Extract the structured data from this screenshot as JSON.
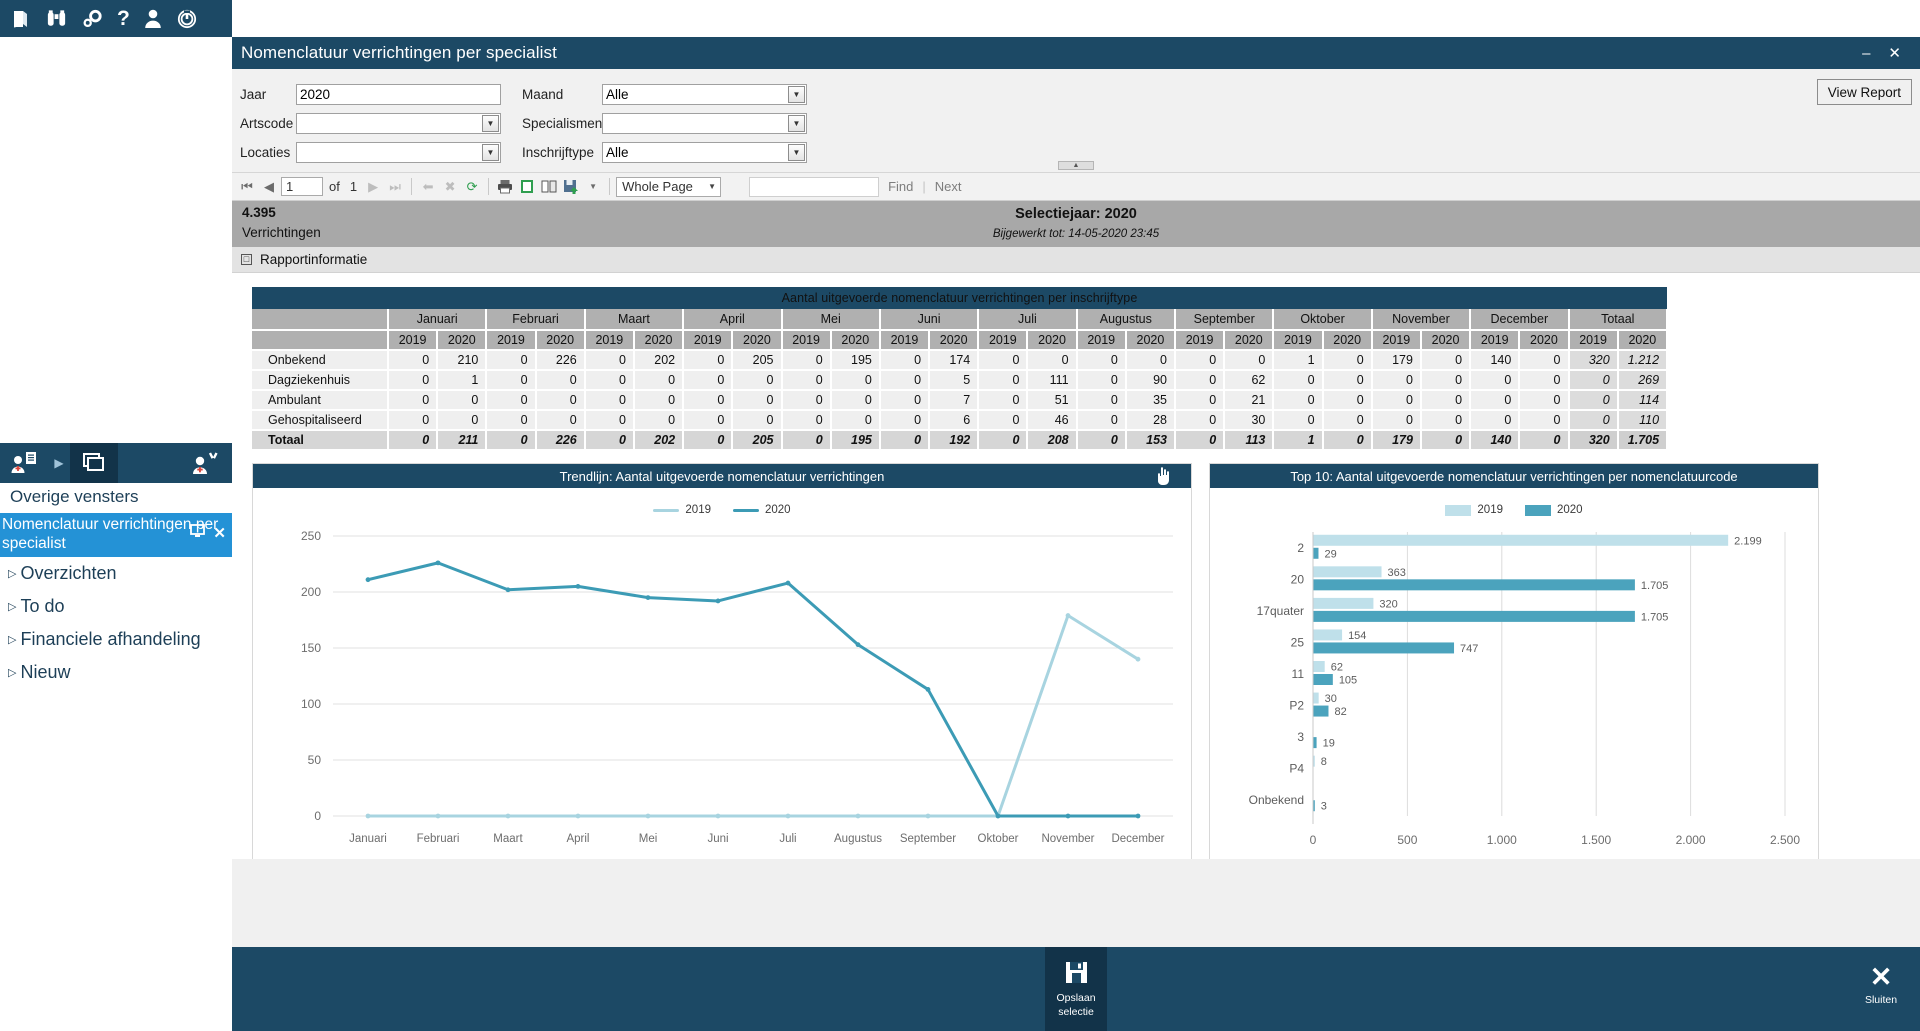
{
  "rail": {
    "icons": [
      "book-icon",
      "binoculars-icon",
      "gears-icon",
      "help-icon",
      "user-icon",
      "power-icon"
    ],
    "window_tabs": [
      "patient-record-icon",
      "chevron-right-icon",
      "windows-icon",
      "patient-search-icon"
    ],
    "overige_vensters_label": "Overige vensters",
    "active_window_label": "Nomenclatuur verrichtingen per specialist",
    "nav_items": [
      {
        "label": "Overzichten"
      },
      {
        "label": "To do"
      },
      {
        "label": "Financiele afhandeling"
      },
      {
        "label": "Nieuw"
      }
    ]
  },
  "window": {
    "title": "Nomenclatuur verrichtingen per specialist",
    "minimize": "–",
    "close": "✕"
  },
  "filters": {
    "left": [
      {
        "label": "Jaar",
        "value": "2020",
        "type": "text"
      },
      {
        "label": "Artscode",
        "value": "",
        "type": "select"
      },
      {
        "label": "Locaties",
        "value": "",
        "type": "select"
      }
    ],
    "right": [
      {
        "label": "Maand",
        "value": "Alle",
        "type": "select"
      },
      {
        "label": "Specialismen",
        "value": "",
        "type": "select"
      },
      {
        "label": "Inschrijftype",
        "value": "Alle",
        "type": "select"
      }
    ],
    "view_report_label": "View Report"
  },
  "report_toolbar": {
    "page_value": "1",
    "of_label": "of",
    "page_count": "1",
    "zoom_value": "Whole Page",
    "find_label": "Find",
    "next_label": "Next",
    "icons": [
      "first-page-icon",
      "prev-page-icon",
      "next-page-icon",
      "last-page-icon",
      "back-icon",
      "stop-icon",
      "refresh-icon",
      "print-icon",
      "print-layout-icon",
      "page-setup-icon",
      "export-icon"
    ]
  },
  "report_header": {
    "count": "4.395",
    "count_label": "Verrichtingen",
    "selection_title": "Selectiejaar: 2020",
    "updated": "Bijgewerkt tot: 14-05-2020 23:45",
    "info_label": "Rapportinformatie"
  },
  "table": {
    "title": "Aantal uitgevoerde nomenclatuur verrichtingen per inschrijftype",
    "months": [
      "Januari",
      "Februari",
      "Maart",
      "April",
      "Mei",
      "Juni",
      "Juli",
      "Augustus",
      "September",
      "Oktober",
      "November",
      "December",
      "Totaal"
    ],
    "years": [
      "2019",
      "2020"
    ],
    "rows": [
      {
        "label": "Onbekend",
        "values": [
          "0",
          "210",
          "0",
          "226",
          "0",
          "202",
          "0",
          "205",
          "0",
          "195",
          "0",
          "174",
          "0",
          "0",
          "0",
          "0",
          "0",
          "0",
          "1",
          "0",
          "179",
          "0",
          "140",
          "0",
          "320",
          "1.212"
        ]
      },
      {
        "label": "Dagziekenhuis",
        "values": [
          "0",
          "1",
          "0",
          "0",
          "0",
          "0",
          "0",
          "0",
          "0",
          "0",
          "0",
          "5",
          "0",
          "111",
          "0",
          "90",
          "0",
          "62",
          "0",
          "0",
          "0",
          "0",
          "0",
          "0",
          "0",
          "269"
        ]
      },
      {
        "label": "Ambulant",
        "values": [
          "0",
          "0",
          "0",
          "0",
          "0",
          "0",
          "0",
          "0",
          "0",
          "0",
          "0",
          "7",
          "0",
          "51",
          "0",
          "35",
          "0",
          "21",
          "0",
          "0",
          "0",
          "0",
          "0",
          "0",
          "0",
          "114"
        ]
      },
      {
        "label": "Gehospitaliseerd",
        "values": [
          "0",
          "0",
          "0",
          "0",
          "0",
          "0",
          "0",
          "0",
          "0",
          "0",
          "0",
          "6",
          "0",
          "46",
          "0",
          "28",
          "0",
          "30",
          "0",
          "0",
          "0",
          "0",
          "0",
          "0",
          "0",
          "110"
        ]
      }
    ],
    "total_row": {
      "label": "Totaal",
      "values": [
        "0",
        "211",
        "0",
        "226",
        "0",
        "202",
        "0",
        "205",
        "0",
        "195",
        "0",
        "192",
        "0",
        "208",
        "0",
        "153",
        "0",
        "113",
        "1",
        "0",
        "179",
        "0",
        "140",
        "0",
        "320",
        "1.705"
      ]
    }
  },
  "chart_data": [
    {
      "type": "line",
      "title": "Trendlijn: Aantal uitgevoerde nomenclatuur verrichtingen",
      "xlabel": "",
      "ylabel": "",
      "ylim": [
        0,
        250
      ],
      "yticks": [
        0,
        50,
        100,
        150,
        200,
        250
      ],
      "grid": true,
      "legend_position": "top",
      "categories": [
        "Januari",
        "Februari",
        "Maart",
        "April",
        "Mei",
        "Juni",
        "Juli",
        "Augustus",
        "September",
        "Oktober",
        "November",
        "December"
      ],
      "series": [
        {
          "name": "2019",
          "color": "#a8d4e0",
          "values": [
            0,
            0,
            0,
            0,
            0,
            0,
            0,
            0,
            0,
            0,
            179,
            140
          ]
        },
        {
          "name": "2020",
          "color": "#3c9bb5",
          "values": [
            211,
            226,
            202,
            205,
            195,
            192,
            208,
            153,
            113,
            0,
            0,
            0
          ]
        }
      ]
    },
    {
      "type": "bar",
      "orientation": "horizontal",
      "title": "Top 10: Aantal uitgevoerde nomenclatuur verrichtingen per nomenclatuurcode",
      "xlabel": "",
      "ylabel": "",
      "xlim": [
        0,
        2500
      ],
      "xticks": [
        0,
        500,
        1000,
        1500,
        2000,
        2500
      ],
      "xtick_labels": [
        "0",
        "500",
        "1.000",
        "1.500",
        "2.000",
        "2.500"
      ],
      "grid": true,
      "legend_position": "top",
      "categories": [
        "2",
        "20",
        "17quater",
        "25",
        "11",
        "P2",
        "3",
        "P4",
        "Onbekend"
      ],
      "series": [
        {
          "name": "2019",
          "color": "#bfe0ea",
          "values": [
            2199,
            363,
            320,
            154,
            62,
            30,
            0,
            8,
            0
          ],
          "labels": [
            "2.199",
            "363",
            "320",
            "154",
            "62",
            "30",
            "",
            "8",
            ""
          ]
        },
        {
          "name": "2020",
          "color": "#4ba3bd",
          "values": [
            29,
            1705,
            1705,
            747,
            105,
            82,
            19,
            0,
            3
          ],
          "labels": [
            "29",
            "1.705",
            "1.705",
            "747",
            "105",
            "82",
            "19",
            "",
            "3"
          ]
        }
      ]
    }
  ],
  "footer": {
    "save_label_line1": "Opslaan",
    "save_label_line2": "selectie",
    "close_label": "Sluiten"
  }
}
